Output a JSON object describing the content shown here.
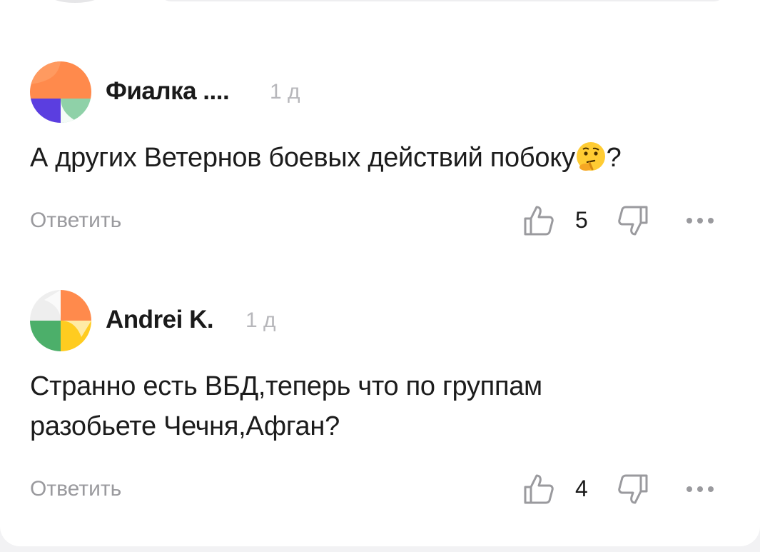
{
  "colors": {
    "text": "#1c1c1c",
    "muted": "#9a9a9e",
    "time": "#b7b7bb",
    "avatar1": [
      "#ff8a4c",
      "#5b3ee0",
      "#8fd1a8"
    ],
    "avatar2": [
      "#ff8a4c",
      "#4caf6a",
      "#ffcc20",
      "#eeeeee"
    ]
  },
  "comments": [
    {
      "author": "Фиалка ....",
      "time": "1 д",
      "text_lines": [
        "А других Ветернов боевых действий побоку",
        "?"
      ],
      "emoji": "thinking-face-icon",
      "reply_label": "Ответить",
      "likes": "5",
      "icons": {
        "like": "thumbs-up-icon",
        "dislike": "thumbs-down-icon",
        "more": "more-dots-icon"
      }
    },
    {
      "author": "Andrei K.",
      "time": "1 д",
      "text_lines": [
        "Странно есть ВБД,теперь что по группам",
        "разобьете Чечня,Афган?"
      ],
      "reply_label": "Ответить",
      "likes": "4",
      "icons": {
        "like": "thumbs-up-icon",
        "dislike": "thumbs-down-icon",
        "more": "more-dots-icon"
      }
    }
  ]
}
